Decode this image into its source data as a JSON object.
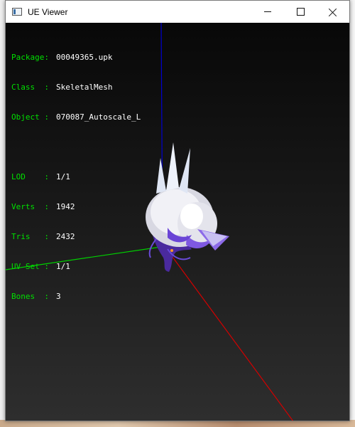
{
  "window": {
    "title": "UE Viewer"
  },
  "info": {
    "package_key": "Package:",
    "package_value": "00049365.upk",
    "class_key": "Class  :",
    "class_value": "SkeletalMesh",
    "object_key": "Object :",
    "object_value": "070087_Autoscale_L",
    "lod_key": "LOD    :",
    "lod_value": "1/1",
    "verts_key": "Verts  :",
    "verts_value": "1942",
    "tris_key": "Tris   :",
    "tris_value": "2432",
    "uvset_key": "UV Set :",
    "uvset_value": "1/1",
    "bones_key": "Bones  :",
    "bones_value": "3"
  },
  "colors": {
    "label": "#00e000",
    "value": "#ffffff",
    "axis_x": "#d40000",
    "axis_y": "#00d000",
    "axis_z": "#0000d0",
    "mesh_primary": "#e8e8ee",
    "mesh_accent": "#6b3fd1"
  }
}
